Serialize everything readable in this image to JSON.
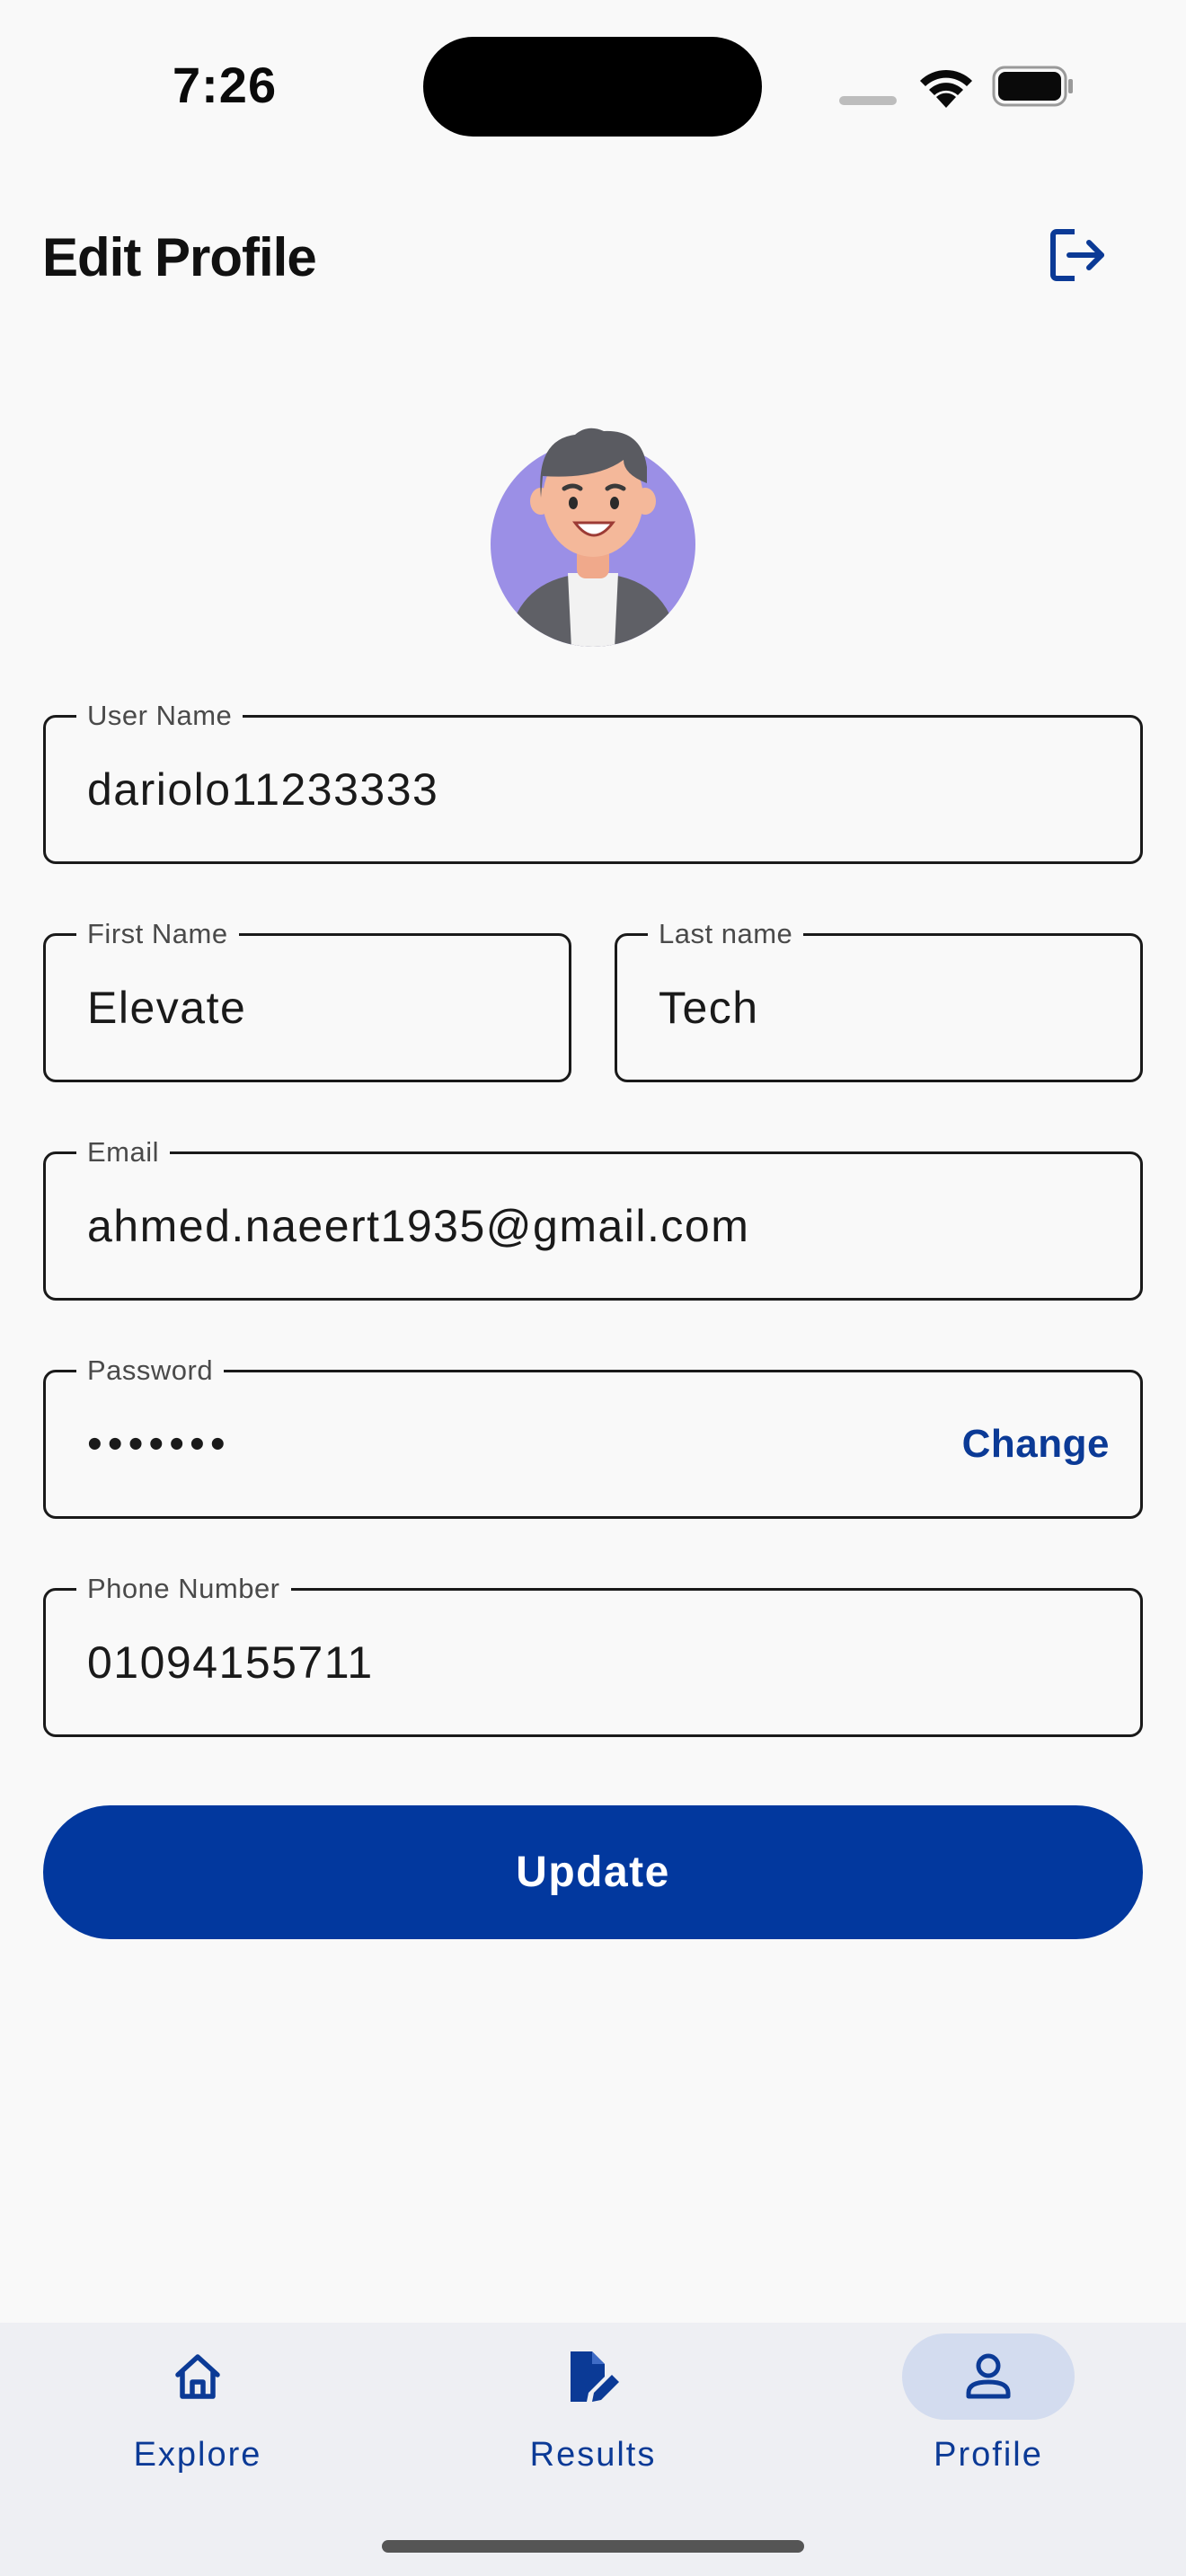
{
  "status_bar": {
    "time": "7:26"
  },
  "header": {
    "title": "Edit Profile",
    "logout_icon": "logout-icon"
  },
  "avatar": {
    "icon": "user-avatar",
    "bg_color": "#9b8fe6"
  },
  "form": {
    "username": {
      "label": "User Name",
      "value": "dariolo11233333"
    },
    "first_name": {
      "label": "First Name",
      "value": "Elevate"
    },
    "last_name": {
      "label": "Last name",
      "value": "Tech"
    },
    "email": {
      "label": "Email",
      "value": "ahmed.naeert1935@gmail.com"
    },
    "password": {
      "label": "Password",
      "value": "•••••••",
      "action": "Change"
    },
    "phone": {
      "label": "Phone Number",
      "value": "01094155711"
    }
  },
  "update_button": {
    "label": "Update",
    "color": "#02389e"
  },
  "bottom_nav": {
    "items": [
      {
        "label": "Explore",
        "icon": "home-icon",
        "active": false
      },
      {
        "label": "Results",
        "icon": "edit-document-icon",
        "active": false
      },
      {
        "label": "Profile",
        "icon": "person-icon",
        "active": true
      }
    ],
    "accent": "#0b3a96"
  }
}
